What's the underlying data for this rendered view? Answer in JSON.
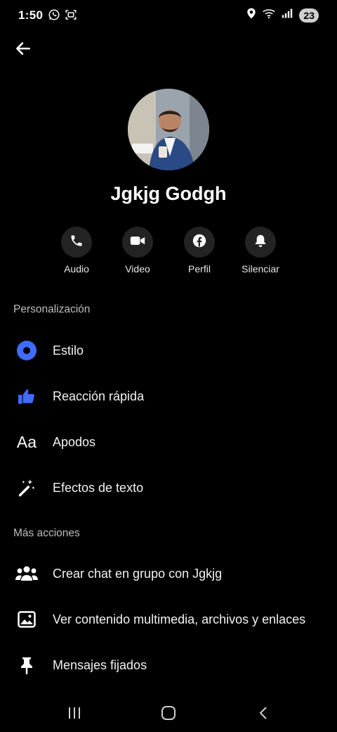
{
  "status_bar": {
    "time": "1:50",
    "left_icons": [
      "whatsapp-icon",
      "screenshot-icon"
    ],
    "right_icons": [
      "location-icon",
      "wifi-icon",
      "signal-icon"
    ],
    "battery": "23"
  },
  "profile": {
    "name": "Jgkjg Godgh"
  },
  "actions": [
    {
      "label": "Audio",
      "icon": "phone-icon"
    },
    {
      "label": "Video",
      "icon": "video-camera-icon"
    },
    {
      "label": "Perfil",
      "icon": "facebook-icon"
    },
    {
      "label": "Silenciar",
      "icon": "bell-icon"
    }
  ],
  "personalization": {
    "title": "Personalización",
    "items": [
      {
        "label": "Estilo",
        "icon": "theme-circle-icon"
      },
      {
        "label": "Reacción rápida",
        "icon": "thumbs-up-icon"
      },
      {
        "label": "Apodos",
        "icon_text": "Aa",
        "icon": "nickname-icon"
      },
      {
        "label": "Efectos de texto",
        "icon": "magic-wand-icon"
      }
    ]
  },
  "more_actions": {
    "title": "Más acciones",
    "items": [
      {
        "label": "Crear chat en grupo con Jgkjg",
        "icon": "group-icon"
      },
      {
        "label": "Ver contenido multimedia, archivos y enlaces",
        "icon": "image-icon"
      },
      {
        "label": "Mensajes fijados",
        "icon": "pin-icon"
      }
    ]
  },
  "colors": {
    "background": "#000000",
    "accent": "#3f6bff",
    "circle_bg": "#232323"
  }
}
